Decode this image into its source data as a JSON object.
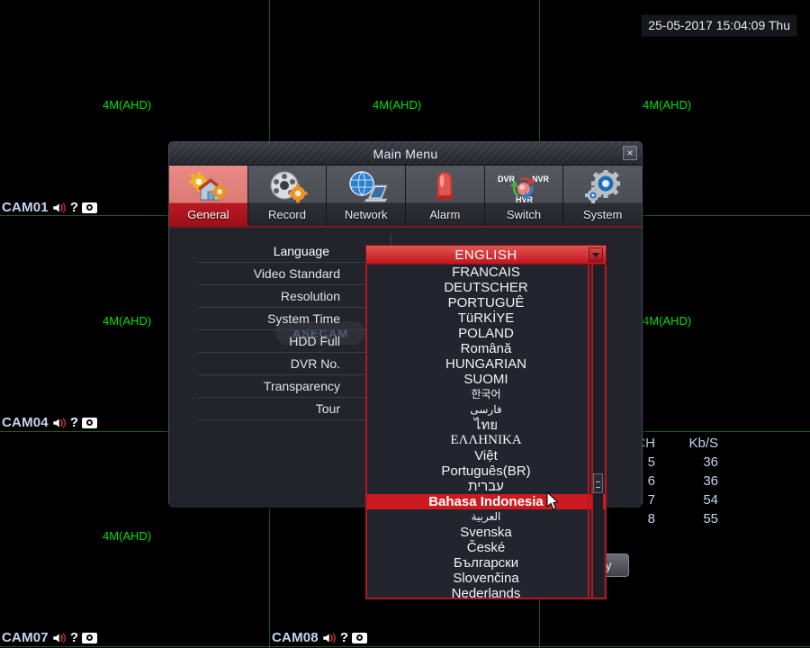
{
  "osd": {
    "timestamp": "25-05-2017 15:04:09 Thu",
    "resolution_tag": "4M(AHD)",
    "cameras": [
      {
        "name": "CAM01"
      },
      {
        "name": "CAM04"
      },
      {
        "name": "CAM07"
      },
      {
        "name": "CAM08"
      }
    ],
    "icons": {
      "speaker": "speaker-muted-icon",
      "question": "?",
      "camera": "camera-record-icon"
    }
  },
  "bandwidth": {
    "headers": [
      "CH",
      "Kb/S"
    ],
    "rows": [
      {
        "ch": "5",
        "rate": "36"
      },
      {
        "ch": "6",
        "rate": "36"
      },
      {
        "ch": "7",
        "rate": "54"
      },
      {
        "ch": "8",
        "rate": "55"
      }
    ]
  },
  "dialog": {
    "title": "Main Menu",
    "close_label": "×",
    "tabs": [
      {
        "label": "General",
        "icon": "house-gear-icon",
        "active": true
      },
      {
        "label": "Record",
        "icon": "disc-gear-icon",
        "active": false
      },
      {
        "label": "Network",
        "icon": "globe-laptop-icon",
        "active": false
      },
      {
        "label": "Alarm",
        "icon": "siren-icon",
        "active": false
      },
      {
        "label": "Switch",
        "icon": "dvr-nvr-hvr-cycle-icon",
        "active": false
      },
      {
        "label": "System",
        "icon": "gear-icon",
        "active": false
      }
    ],
    "settings": [
      {
        "label": "Language",
        "selected": true
      },
      {
        "label": "Video Standard",
        "selected": false
      },
      {
        "label": "Resolution",
        "selected": false
      },
      {
        "label": "System Time",
        "selected": false
      },
      {
        "label": "HDD Full",
        "selected": false
      },
      {
        "label": "DVR No.",
        "selected": false
      },
      {
        "label": "Transparency",
        "selected": false
      },
      {
        "label": "Tour",
        "selected": false
      }
    ],
    "apply_label": "Apply",
    "watermark": "ASECAM"
  },
  "language_dropdown": {
    "selected": "ENGLISH",
    "options": [
      {
        "label": "FRANCAIS",
        "style": "normal"
      },
      {
        "label": "DEUTSCHER",
        "style": "normal"
      },
      {
        "label": "PORTUGUÊ",
        "style": "normal"
      },
      {
        "label": "TüRKİYE",
        "style": "normal"
      },
      {
        "label": "POLAND",
        "style": "normal"
      },
      {
        "label": "Română",
        "style": "normal"
      },
      {
        "label": "HUNGARIAN",
        "style": "normal"
      },
      {
        "label": "SUOMI",
        "style": "normal"
      },
      {
        "label": "한국어",
        "style": "small"
      },
      {
        "label": "فارسی",
        "style": "small"
      },
      {
        "label": "ไทย",
        "style": "normal"
      },
      {
        "label": "ΕΛΛΗΝΙΚΑ",
        "style": "serif"
      },
      {
        "label": "Việt",
        "style": "normal"
      },
      {
        "label": "Português(BR)",
        "style": "normal"
      },
      {
        "label": "עברית",
        "style": "normal"
      },
      {
        "label": "Bahasa Indonesia",
        "style": "normal",
        "selected": true
      },
      {
        "label": "العربية",
        "style": "small"
      },
      {
        "label": "Svenska",
        "style": "normal"
      },
      {
        "label": "České",
        "style": "normal"
      },
      {
        "label": "Български",
        "style": "normal"
      },
      {
        "label": "Slovenčina",
        "style": "normal"
      },
      {
        "label": "Nederlands",
        "style": "normal"
      }
    ]
  },
  "colors": {
    "accent_red": "#cc1b20",
    "grid_green": "#1d5a1d",
    "osd_green": "#00e000",
    "panel_bg": "#22242c"
  }
}
